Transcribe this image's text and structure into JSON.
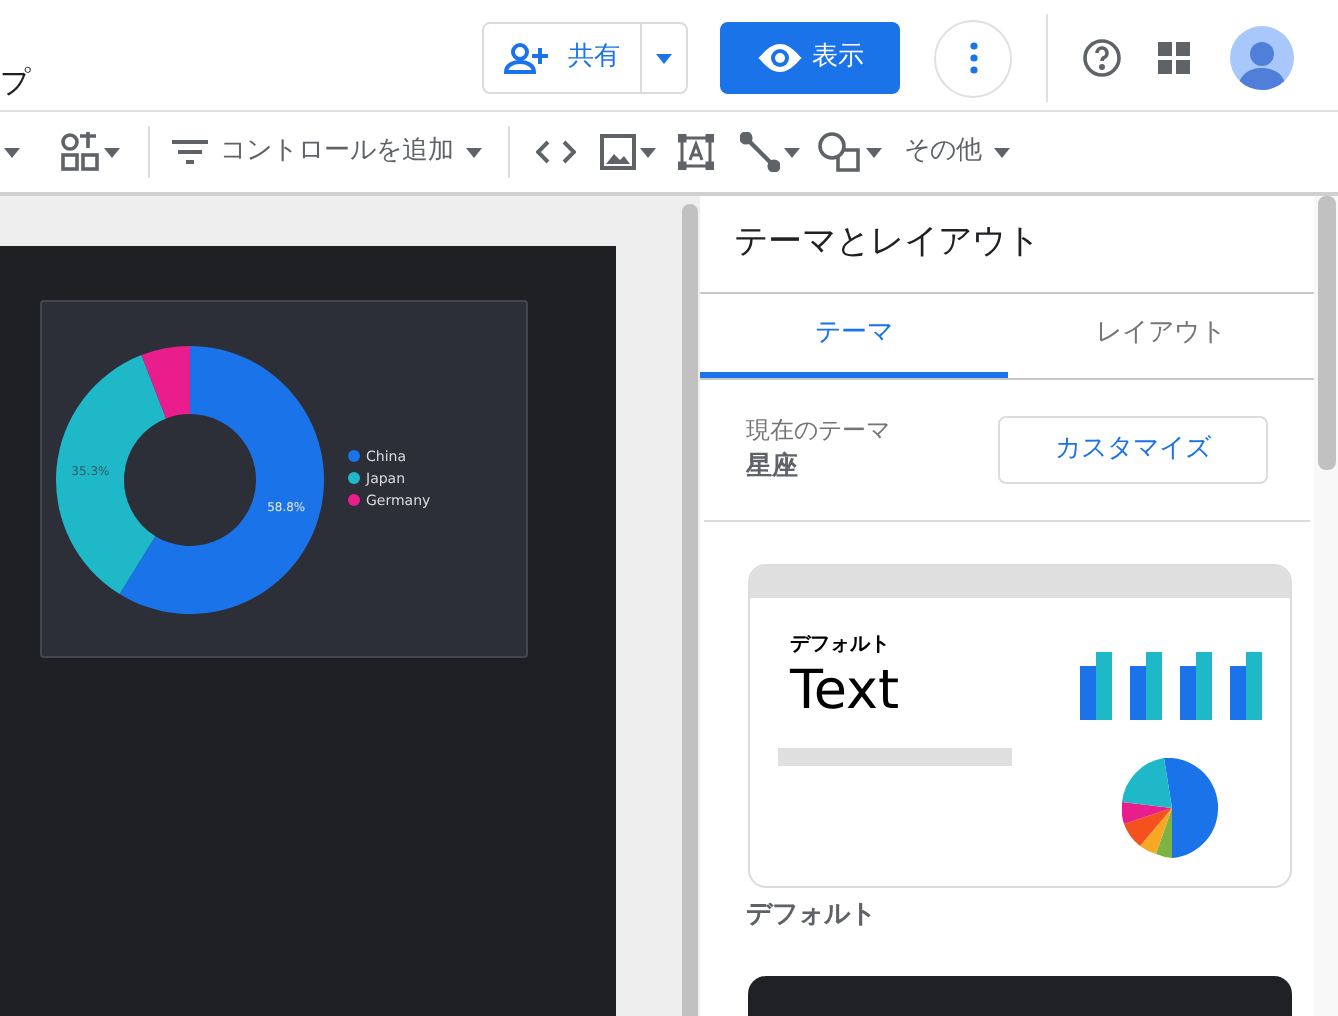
{
  "header": {
    "title_fragment": "プ",
    "share_button": {
      "label": "共有"
    },
    "view_button": {
      "label": "表示"
    }
  },
  "toolbar": {
    "add_control": "コントロールを追加",
    "more": "その他"
  },
  "canvas": {
    "chart": {
      "chart_data": {
        "type": "donut",
        "values": [
          58.8,
          35.3,
          5.9
        ],
        "value_labels": [
          "58.8%",
          "35.3%",
          null
        ]
      },
      "legend": [
        {
          "label": "China",
          "color": "#1a73e8"
        },
        {
          "label": "Japan",
          "color": "#1fb8c9"
        },
        {
          "label": "Germany",
          "color": "#e91e8c"
        }
      ]
    }
  },
  "panel": {
    "title": "テーマとレイアウト",
    "tabs": [
      {
        "label": "テーマ",
        "selected": true
      },
      {
        "label": "レイアウト",
        "selected": false
      }
    ],
    "current_theme": {
      "label": "現在のテーマ",
      "value": "星座",
      "customize_button": "カスタマイズ"
    },
    "theme_card": {
      "heading": "デフォルト",
      "sample_text": "Text",
      "caption": "デフォルト"
    }
  }
}
